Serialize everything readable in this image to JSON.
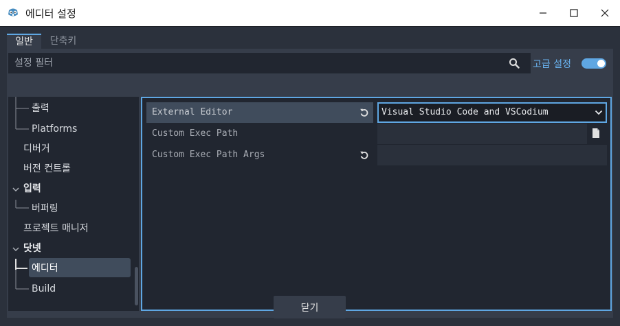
{
  "window": {
    "title": "에디터 설정"
  },
  "tabs": [
    {
      "label": "일반"
    },
    {
      "label": "단축키"
    }
  ],
  "filter": {
    "placeholder": "설정 필터"
  },
  "advanced": {
    "label": "고급 설정",
    "enabled": true
  },
  "tree": {
    "items": [
      {
        "label": "출력"
      },
      {
        "label": "Platforms"
      },
      {
        "label": "디버거"
      },
      {
        "label": "버전 컨트롤"
      },
      {
        "label": "입력"
      },
      {
        "label": "버퍼링"
      },
      {
        "label": "프로젝트 매니저"
      },
      {
        "label": "닷넷"
      },
      {
        "label": "에디터",
        "selected": true
      },
      {
        "label": "Build"
      }
    ]
  },
  "properties": [
    {
      "label": "External Editor",
      "value": "Visual Studio Code and VSCodium",
      "revertable": true
    },
    {
      "label": "Custom Exec Path",
      "value": ""
    },
    {
      "label": "Custom Exec Path Args",
      "value": "",
      "revertable": true
    }
  ],
  "footer": {
    "close_label": "닫기"
  },
  "colors": {
    "accent": "#5fa7e3",
    "panel": "#363d4a",
    "field": "#212630"
  },
  "icons": [
    "godot-icon",
    "minimize-icon",
    "maximize-icon",
    "close-icon",
    "search-icon",
    "revert-icon",
    "chevron-down-icon",
    "file-icon"
  ]
}
